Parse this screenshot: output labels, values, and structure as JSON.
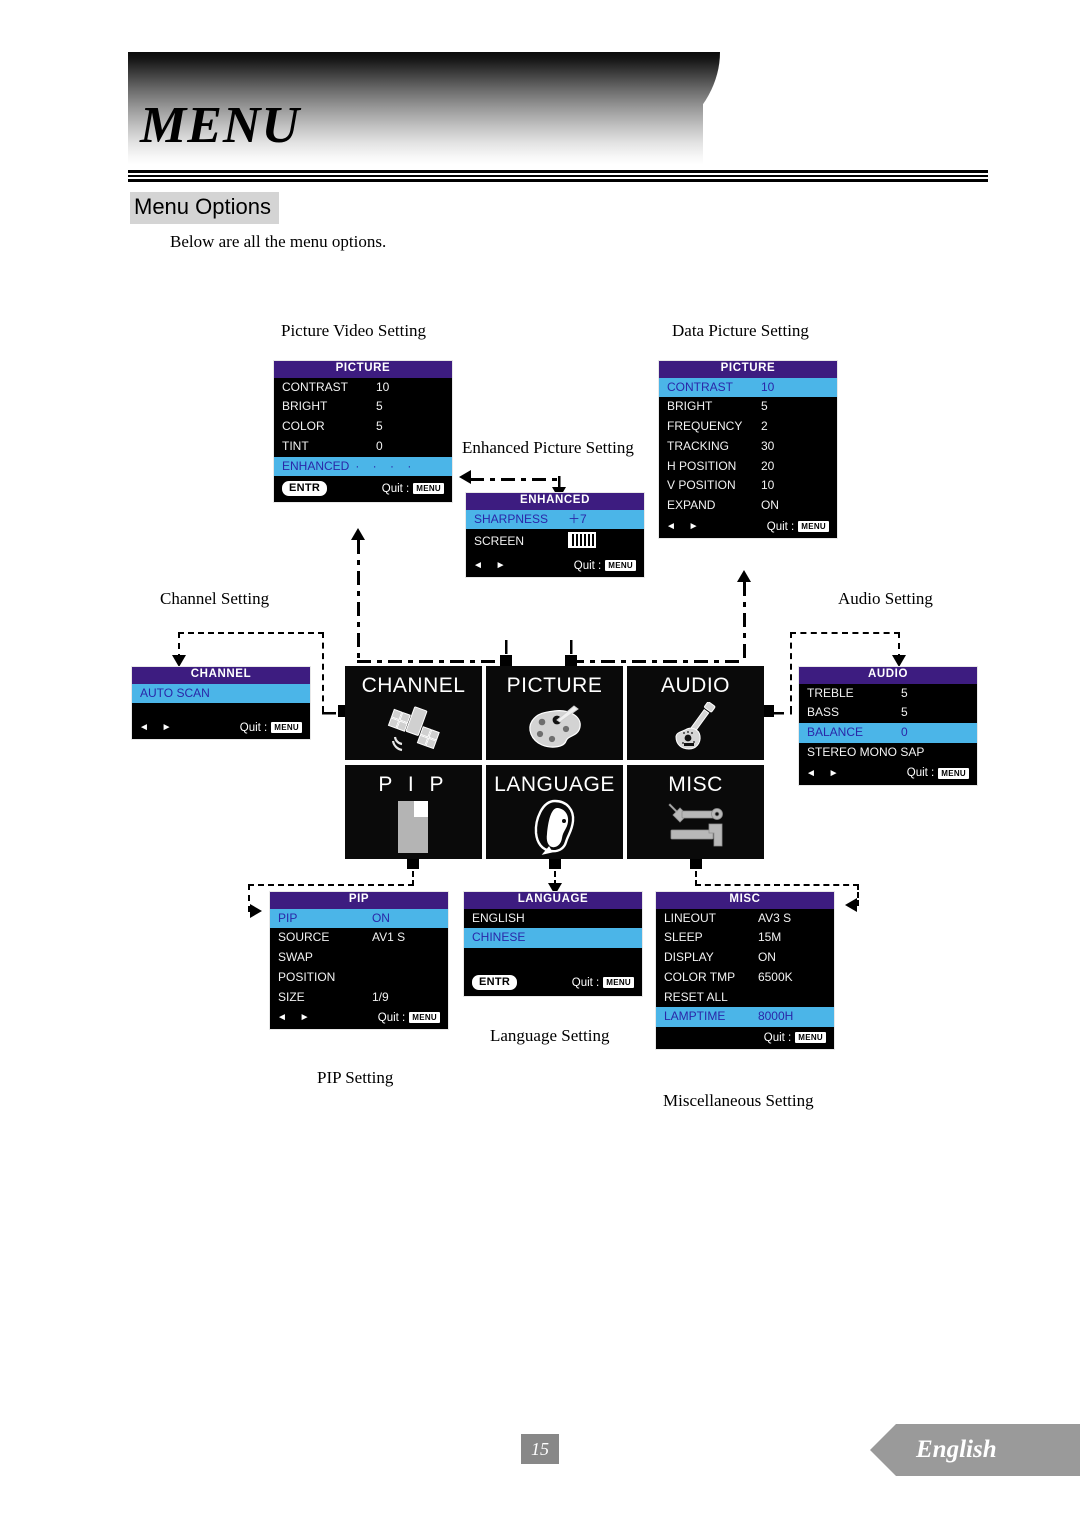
{
  "header": {
    "title": "MENU",
    "section_heading": "Menu Options",
    "intro": "Below are all the menu options."
  },
  "captions": {
    "picture_video": "Picture Video Setting",
    "data_picture": "Data Picture Setting",
    "enhanced_picture": "Enhanced Picture Setting",
    "channel": "Channel Setting",
    "audio": "Audio Setting",
    "pip": "PIP Setting",
    "language": "Language Setting",
    "misc": "Miscellaneous Setting"
  },
  "common": {
    "quit_label": "Quit :",
    "menu_key": "MENU",
    "entr_key": "ENTR",
    "left_arrow": "◄",
    "right_arrow": "►"
  },
  "menus": {
    "picture_video": {
      "title": "PICTURE",
      "rows": [
        {
          "label": "CONTRAST",
          "value": "10",
          "highlight": false
        },
        {
          "label": "BRIGHT",
          "value": "5",
          "highlight": false
        },
        {
          "label": "COLOR",
          "value": "5",
          "highlight": false
        },
        {
          "label": "TINT",
          "value": "0",
          "highlight": false
        },
        {
          "label": "ENHANCED",
          "value": "·   ·   ·   ·",
          "highlight": true
        }
      ]
    },
    "data_picture": {
      "title": "PICTURE",
      "rows": [
        {
          "label": "CONTRAST",
          "value": "10",
          "highlight": true
        },
        {
          "label": "BRIGHT",
          "value": "5",
          "highlight": false
        },
        {
          "label": "FREQUENCY",
          "value": "2",
          "highlight": false
        },
        {
          "label": "TRACKING",
          "value": "30",
          "highlight": false
        },
        {
          "label": "H POSITION",
          "value": "20",
          "highlight": false
        },
        {
          "label": "V POSITION",
          "value": "10",
          "highlight": false
        },
        {
          "label": "EXPAND",
          "value": "ON",
          "highlight": false
        }
      ]
    },
    "enhanced": {
      "title": "ENHANCED",
      "rows": [
        {
          "label": "SHARPNESS",
          "value": "＋7",
          "highlight": true
        },
        {
          "label": "SCREEN",
          "value": "screen-pattern-icon",
          "highlight": false
        }
      ]
    },
    "channel": {
      "title": "CHANNEL",
      "rows": [
        {
          "label": "AUTO SCAN",
          "value": "",
          "highlight": true
        }
      ]
    },
    "audio": {
      "title": "AUDIO",
      "rows": [
        {
          "label": "TREBLE",
          "value": "5",
          "highlight": false
        },
        {
          "label": "BASS",
          "value": "5",
          "highlight": false
        },
        {
          "label": "BALANCE",
          "value": "0",
          "highlight": true
        },
        {
          "label": "STEREO  MONO  SAP",
          "value": "",
          "highlight": false
        }
      ]
    },
    "pip": {
      "title": "PIP",
      "rows": [
        {
          "label": "PIP",
          "value": "ON",
          "highlight": true
        },
        {
          "label": "SOURCE",
          "value": "AV1 S",
          "highlight": false
        },
        {
          "label": "SWAP",
          "value": "",
          "highlight": false
        },
        {
          "label": "POSITION",
          "value": "",
          "highlight": false
        },
        {
          "label": "SIZE",
          "value": "1/9",
          "highlight": false
        }
      ]
    },
    "language": {
      "title": "LANGUAGE",
      "rows": [
        {
          "label": "ENGLISH",
          "value": "",
          "highlight": false
        },
        {
          "label": "CHINESE",
          "value": "",
          "highlight": true
        }
      ]
    },
    "misc": {
      "title": "MISC",
      "rows": [
        {
          "label": "LINEOUT",
          "value": "AV3 S",
          "highlight": false
        },
        {
          "label": "SLEEP",
          "value": "15M",
          "highlight": false
        },
        {
          "label": "DISPLAY",
          "value": "ON",
          "highlight": false
        },
        {
          "label": "COLOR TMP",
          "value": "6500K",
          "highlight": false
        },
        {
          "label": "RESET ALL",
          "value": "",
          "highlight": false
        },
        {
          "label": "LAMPTIME",
          "value": "8000H",
          "highlight": true
        }
      ]
    }
  },
  "tiles": [
    {
      "label": "CHANNEL",
      "icon": "satellite-dish-icon"
    },
    {
      "label": "PICTURE",
      "icon": "paint-palette-icon"
    },
    {
      "label": "AUDIO",
      "icon": "guitar-icon"
    },
    {
      "label": "P I P",
      "icon": "picture-in-picture-icon"
    },
    {
      "label": "LANGUAGE",
      "icon": "speaking-head-icon"
    },
    {
      "label": "MISC",
      "icon": "wrench-hammer-icon"
    }
  ],
  "footer": {
    "page_number": "15",
    "language_tab": "English"
  },
  "colors": {
    "title_bar_purple": "#3d1c80",
    "highlight_blue": "#4bb5e8",
    "highlight_text": "#2a27a8",
    "osd_background": "#000000",
    "heading_background": "#d4d4d4",
    "footer_gray": "#9a9a9a"
  }
}
